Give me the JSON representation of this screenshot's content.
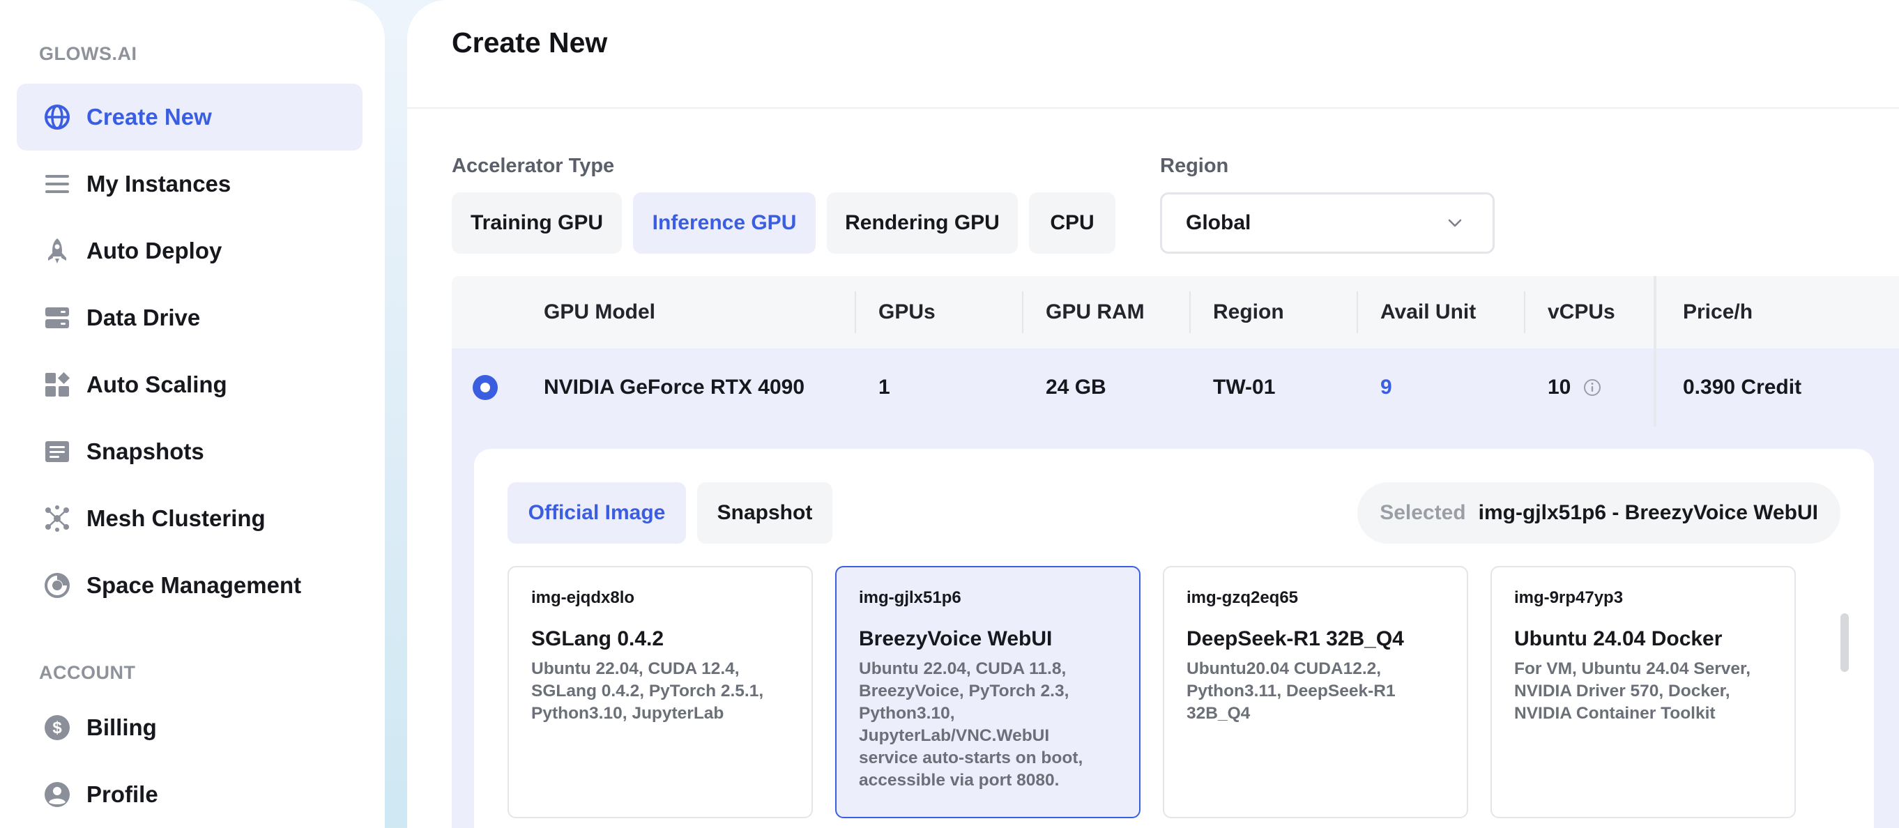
{
  "sidebar": {
    "brand": "GLOWS.AI",
    "items": [
      {
        "label": "Create New",
        "icon": "globe-icon",
        "active": true
      },
      {
        "label": "My Instances",
        "icon": "list-icon"
      },
      {
        "label": "Auto Deploy",
        "icon": "rocket-icon"
      },
      {
        "label": "Data Drive",
        "icon": "storage-icon"
      },
      {
        "label": "Auto Scaling",
        "icon": "widgets-icon"
      },
      {
        "label": "Snapshots",
        "icon": "snapshot-icon"
      },
      {
        "label": "Mesh Clustering",
        "icon": "cluster-icon"
      },
      {
        "label": "Space Management",
        "icon": "space-icon"
      }
    ],
    "account_title": "ACCOUNT",
    "account_items": [
      {
        "label": "Billing",
        "icon": "dollar-icon"
      },
      {
        "label": "Profile",
        "icon": "user-icon"
      }
    ]
  },
  "main": {
    "title": "Create New",
    "accelerator": {
      "label": "Accelerator Type",
      "options": [
        "Training GPU",
        "Inference GPU",
        "Rendering GPU",
        "CPU"
      ],
      "selected": "Inference GPU"
    },
    "region": {
      "label": "Region",
      "value": "Global"
    },
    "table": {
      "headers": [
        "GPU Model",
        "GPUs",
        "GPU RAM",
        "Region",
        "Avail Unit",
        "vCPUs",
        "Price/h"
      ],
      "row": {
        "model": "NVIDIA GeForce RTX 4090",
        "gpus": "1",
        "gpu_ram": "24 GB",
        "region": "TW-01",
        "avail_unit": "9",
        "vcpus": "10",
        "price": "0.390 Credit"
      }
    },
    "images": {
      "tabs": [
        "Official Image",
        "Snapshot"
      ],
      "active_tab": "Official Image",
      "selected_label": "Selected",
      "selected_value": "img-gjlx51p6 - BreezyVoice WebUI",
      "cards": [
        {
          "id": "img-ejqdx8lo",
          "name": "SGLang 0.4.2",
          "desc_lines": [
            "Ubuntu 22.04, CUDA 12.4,",
            "SGLang 0.4.2, PyTorch 2.5.1,",
            "Python3.10, JupyterLab"
          ]
        },
        {
          "id": "img-gjlx51p6",
          "name": "BreezyVoice WebUI",
          "desc_lines": [
            "Ubuntu 22.04, CUDA 11.8,",
            "BreezyVoice, PyTorch 2.3,",
            "Python3.10,",
            "JupyterLab/VNC.WebUI",
            "service auto-starts on boot,",
            "accessible via port 8080."
          ]
        },
        {
          "id": "img-gzq2eq65",
          "name": "DeepSeek-R1 32B_Q4",
          "desc_lines": [
            "Ubuntu20.04 CUDA12.2,",
            "Python3.11, DeepSeek-R1",
            "32B_Q4"
          ]
        },
        {
          "id": "img-9rp47yp3",
          "name": "Ubuntu 24.04 Docker",
          "desc_lines": [
            "For VM, Ubuntu 24.04 Server,",
            "NVIDIA Driver 570, Docker,",
            "NVIDIA Container Toolkit"
          ]
        }
      ]
    }
  },
  "colors": {
    "accent": "#3b5ee0",
    "accent_bg": "#eceefb",
    "muted": "#8e929b"
  }
}
